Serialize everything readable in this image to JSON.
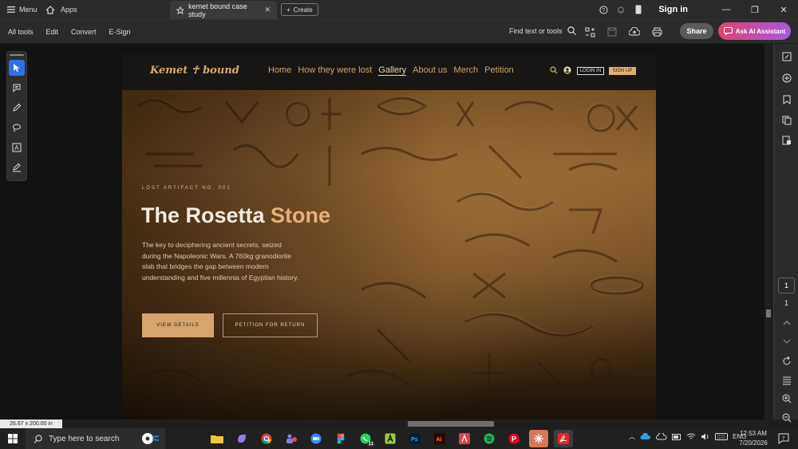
{
  "titlebar": {
    "menu_label": "Menu",
    "apps_label": "Apps",
    "tab_title": "kemet bound case study",
    "create_label": "Create",
    "signin_label": "Sign in"
  },
  "toolbar": {
    "items": [
      "All tools",
      "Edit",
      "Convert",
      "E-Sign"
    ],
    "find_label": "Find text or tools",
    "share_label": "Share",
    "ai_label": "Ask AI Assistant"
  },
  "website": {
    "logo_left": "Kemet",
    "logo_right": "bound",
    "logo_ankh": "☥",
    "nav": [
      "Home",
      "How they were lost",
      "Gallery",
      "About us",
      "Merch",
      "Petition"
    ],
    "nav_active_index": 2,
    "login_label": "LOGIN IN",
    "signup_label": "SIGN UP",
    "hero": {
      "eyebrow": "LOST ARTIFACT NO. 001",
      "title_main": "The Rosetta",
      "title_accent": "Stone",
      "description": "The key to deciphering ancient secrets, seized during the Napoleonic Wars. A 760kg granodiorite slab that bridges the gap between modern understanding and five millennia of Egyptian history.",
      "primary_button": "VIEW DETAILS",
      "secondary_button": "PETITION FOR RETURN"
    }
  },
  "page_nav": {
    "current_page": "1",
    "total_pages": "1"
  },
  "status": {
    "page_size": "26.67 x 200.00 in"
  },
  "taskbar": {
    "search_placeholder": "Type here to search",
    "whatsapp_badge": "11",
    "tray_lang": "ENG",
    "time": "12:53 AM",
    "date": "7/20/2026"
  },
  "colors": {
    "accent_gold": "#e0b06e",
    "ai_gradient_start": "#e0436e",
    "ai_gradient_end": "#a65adf",
    "active_tool_blue": "#2f6fe0"
  }
}
